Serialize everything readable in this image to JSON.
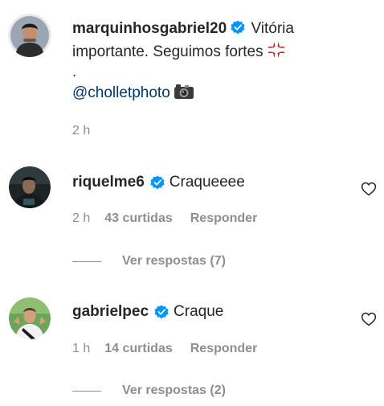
{
  "post": {
    "author": "marquinhosgabriel20",
    "caption_text": "Vitória importante. Seguimos fortes",
    "dot": ".",
    "mention": "@cholletphoto",
    "timestamp": "2 h",
    "anger_emoji": "anger-symbol-icon",
    "camera_emoji": "camera-icon"
  },
  "comments": [
    {
      "username": "riquelme6",
      "text": "Craqueeee",
      "timestamp": "2 h",
      "likes": "43 curtidas",
      "reply_label": "Responder",
      "view_replies": "Ver respostas (7)"
    },
    {
      "username": "gabrielpec",
      "text": "Craque",
      "timestamp": "1 h",
      "likes": "14 curtidas",
      "reply_label": "Responder",
      "view_replies": "Ver respostas (2)"
    }
  ],
  "colors": {
    "text": "#262626",
    "secondary": "#8e8e8e",
    "mention": "#00376b",
    "verified": "#0095f6",
    "anger_emoji": "#b3262b"
  }
}
